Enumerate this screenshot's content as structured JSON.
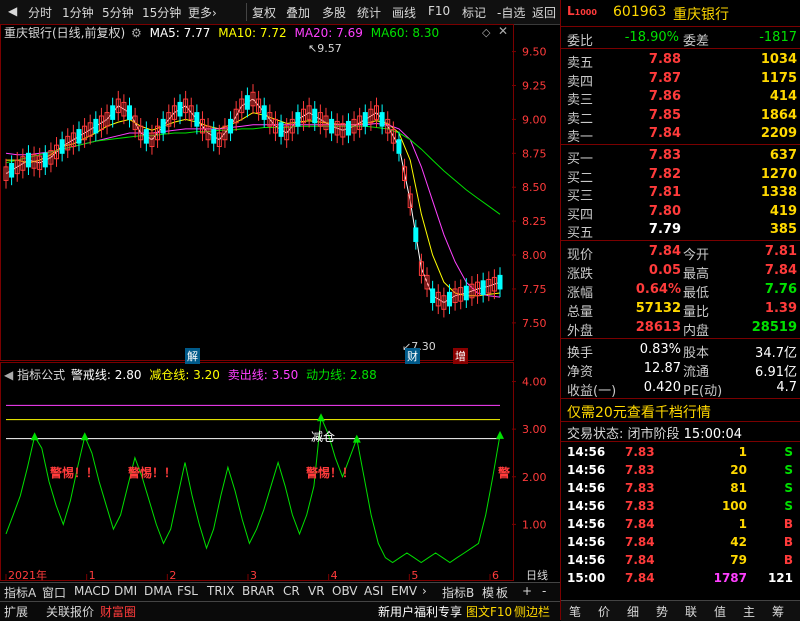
{
  "menu": {
    "items": [
      "分时",
      "1分钟",
      "5分钟",
      "15分钟",
      "更多›",
      "复权",
      "叠加",
      "多股",
      "统计",
      "画线",
      "F10",
      "标记",
      "-自选",
      "返回"
    ]
  },
  "main_chart": {
    "header": {
      "title": "重庆银行(日线,前复权)",
      "ma5_label": "MA5: 7.77",
      "ma10_label": "MA10: 7.72",
      "ma20_label": "MA20: 7.69",
      "ma60_label": "MA60: 8.30"
    },
    "annotation_high": "9.57",
    "annotation_low": "7.30",
    "markers": [
      "解",
      "财",
      "增"
    ],
    "colors": {
      "ma5": "#ffffff",
      "ma10": "#ffff00",
      "ma20": "#ff40ff",
      "ma60": "#00e000",
      "up": "#ff3b3b",
      "down": "#00ffff"
    }
  },
  "indicator": {
    "header": {
      "name": "指标公式",
      "warn_label": "警戒线: 2.80",
      "reduce_label": "减仓线: 3.20",
      "sell_label": "卖出线: 3.50",
      "power_label": "动力线: 2.88"
    },
    "warn_texts": [
      "警惕！！",
      "警惕！！",
      "警惕！！",
      "警"
    ],
    "reduce_text": "减仓"
  },
  "chart_data": [
    {
      "type": "candlestick",
      "title": "重庆银行(日线,前复权)",
      "ylim": [
        7.3,
        9.6
      ],
      "yticks": [
        7.5,
        7.75,
        8.0,
        8.25,
        8.5,
        8.75,
        9.0,
        9.25,
        9.5
      ],
      "ytick_labels": [
        "7.50",
        "7.75",
        "8.00",
        "8.25",
        "8.50",
        "8.75",
        "9.00",
        "9.25",
        "9.50"
      ],
      "series": [
        {
          "name": "MA5: 7.77",
          "values": [
            8.6,
            8.65,
            8.7,
            8.68,
            8.72,
            8.8,
            8.85,
            8.9,
            8.95,
            9.0,
            9.1,
            9.05,
            8.9,
            8.85,
            8.95,
            9.05,
            9.1,
            9.0,
            8.9,
            8.85,
            8.95,
            9.1,
            9.15,
            9.05,
            8.95,
            8.9,
            9.0,
            9.05,
            9.0,
            8.95,
            8.92,
            8.95,
            9.0,
            9.05,
            8.95,
            8.8,
            8.4,
            7.9,
            7.7,
            7.65,
            7.7,
            7.72,
            7.75,
            7.77,
            7.8
          ]
        },
        {
          "name": "MA10: 7.72",
          "values": [
            8.7,
            8.7,
            8.68,
            8.7,
            8.74,
            8.8,
            8.82,
            8.86,
            8.9,
            8.95,
            8.98,
            9.0,
            8.95,
            8.92,
            8.95,
            8.98,
            9.0,
            8.98,
            8.95,
            8.93,
            8.96,
            9.0,
            9.05,
            9.03,
            9.0,
            8.97,
            8.98,
            8.99,
            8.98,
            8.97,
            8.96,
            8.96,
            8.97,
            8.99,
            8.97,
            8.9,
            8.7,
            8.3,
            8.0,
            7.8,
            7.72,
            7.7,
            7.7,
            7.71,
            7.72
          ]
        },
        {
          "name": "MA20: 7.69",
          "values": [
            8.75,
            8.74,
            8.74,
            8.75,
            8.76,
            8.78,
            8.8,
            8.82,
            8.84,
            8.86,
            8.88,
            8.9,
            8.9,
            8.9,
            8.91,
            8.92,
            8.93,
            8.93,
            8.93,
            8.93,
            8.94,
            8.95,
            8.96,
            8.96,
            8.96,
            8.96,
            8.96,
            8.96,
            8.96,
            8.96,
            8.96,
            8.96,
            8.96,
            8.97,
            8.96,
            8.93,
            8.85,
            8.65,
            8.4,
            8.15,
            7.95,
            7.8,
            7.72,
            7.7,
            7.69
          ]
        },
        {
          "name": "MA60: 8.30",
          "values": [
            8.68,
            8.7,
            8.72,
            8.74,
            8.76,
            8.78,
            8.8,
            8.82,
            8.84,
            8.85,
            8.86,
            8.87,
            8.88,
            8.88,
            8.89,
            8.9,
            8.9,
            8.91,
            8.91,
            8.92,
            8.92,
            8.93,
            8.93,
            8.94,
            8.94,
            8.94,
            8.95,
            8.95,
            8.95,
            8.95,
            8.95,
            8.95,
            8.95,
            8.94,
            8.93,
            8.9,
            8.85,
            8.78,
            8.7,
            8.62,
            8.55,
            8.48,
            8.42,
            8.36,
            8.3
          ]
        }
      ],
      "annotations": [
        "9.57",
        "7.30"
      ]
    },
    {
      "type": "line",
      "title": "指标公式",
      "ylim": [
        0,
        4.2
      ],
      "yticks": [
        1.0,
        2.0,
        3.0,
        4.0
      ],
      "ytick_labels": [
        "1.00",
        "2.00",
        "3.00",
        "4.00"
      ],
      "x_labels": [
        "2021年",
        "1",
        "2",
        "3",
        "4",
        "5",
        "6"
      ],
      "xlabel": "日线",
      "series": [
        {
          "name": "警戒线: 2.80",
          "values": [
            2.8,
            2.8
          ]
        },
        {
          "name": "减仓线: 3.20",
          "values": [
            3.2,
            3.2
          ]
        },
        {
          "name": "卖出线: 3.50",
          "values": [
            3.5,
            3.5
          ]
        },
        {
          "name": "动力线: 2.88",
          "values": [
            0.8,
            1.2,
            1.6,
            2.2,
            2.85,
            2.6,
            1.9,
            1.4,
            1.0,
            1.5,
            2.2,
            2.85,
            2.5,
            1.9,
            1.4,
            0.9,
            1.2,
            1.8,
            2.4,
            2.0,
            1.5,
            1.0,
            0.6,
            0.9,
            1.6,
            2.3,
            1.6,
            1.0,
            0.5,
            0.9,
            1.6,
            2.2,
            1.7,
            1.1,
            0.6,
            0.9,
            1.3,
            1.8,
            2.3,
            1.8,
            1.2,
            0.8,
            1.2,
            1.8,
            3.25,
            2.9,
            2.4,
            2.0,
            2.4,
            2.8,
            2.0,
            1.2,
            0.6,
            0.3,
            0.2,
            0.3,
            0.4,
            0.3,
            0.2,
            0.3,
            0.4,
            0.3,
            0.2,
            0.3,
            0.4,
            0.5,
            0.6,
            1.2,
            2.0,
            2.88
          ]
        }
      ]
    }
  ],
  "quote_panel": {
    "code": "601963",
    "name": "重庆银行",
    "weibi_label": "委比",
    "weibi": "-18.90%",
    "weicha_label": "委差",
    "weicha": "-1817",
    "asks": [
      {
        "label": "卖五",
        "price": "7.88",
        "vol": "1034"
      },
      {
        "label": "卖四",
        "price": "7.87",
        "vol": "1175"
      },
      {
        "label": "卖三",
        "price": "7.86",
        "vol": "414"
      },
      {
        "label": "卖二",
        "price": "7.85",
        "vol": "1864"
      },
      {
        "label": "卖一",
        "price": "7.84",
        "vol": "2209"
      }
    ],
    "bids": [
      {
        "label": "买一",
        "price": "7.83",
        "vol": "637"
      },
      {
        "label": "买二",
        "price": "7.82",
        "vol": "1270"
      },
      {
        "label": "买三",
        "price": "7.81",
        "vol": "1338"
      },
      {
        "label": "买四",
        "price": "7.80",
        "vol": "419"
      },
      {
        "label": "买五",
        "price": "7.79",
        "vol": "385"
      }
    ],
    "stats": [
      {
        "l1": "现价",
        "v1": "7.84",
        "l2": "今开",
        "v2": "7.81"
      },
      {
        "l1": "涨跌",
        "v1": "0.05",
        "l2": "最高",
        "v2": "7.84"
      },
      {
        "l1": "涨幅",
        "v1": "0.64%",
        "l2": "最低",
        "v2": "7.76"
      },
      {
        "l1": "总量",
        "v1": "57132",
        "l2": "量比",
        "v2": "1.39"
      },
      {
        "l1": "外盘",
        "v1": "28613",
        "l2": "内盘",
        "v2": "28519"
      }
    ],
    "stats2": [
      {
        "l1": "换手",
        "v1": "0.83%",
        "l2": "股本",
        "v2": "34.7亿"
      },
      {
        "l1": "净资",
        "v1": "12.87",
        "l2": "流通",
        "v2": "6.91亿"
      },
      {
        "l1": "收益(一)",
        "v1": "0.420",
        "l2": "PE(动)",
        "v2": "4.7"
      }
    ],
    "promo": "仅需20元查看千档行情",
    "status_label": "交易状态: 闭市阶段",
    "status_time": "15:00:04",
    "ticks": [
      {
        "time": "14:56",
        "price": "7.83",
        "vol": "1",
        "bs": "S"
      },
      {
        "time": "14:56",
        "price": "7.83",
        "vol": "20",
        "bs": "S"
      },
      {
        "time": "14:56",
        "price": "7.83",
        "vol": "81",
        "bs": "S"
      },
      {
        "time": "14:56",
        "price": "7.83",
        "vol": "100",
        "bs": "S"
      },
      {
        "time": "14:56",
        "price": "7.84",
        "vol": "1",
        "bs": "B"
      },
      {
        "time": "14:56",
        "price": "7.84",
        "vol": "42",
        "bs": "B"
      },
      {
        "time": "14:56",
        "price": "7.84",
        "vol": "79",
        "bs": "B"
      },
      {
        "time": "15:00",
        "price": "7.84",
        "vol": "1787",
        "bs": "121"
      }
    ]
  },
  "bottom_tabs": {
    "row1": [
      "指标A",
      "窗口",
      "MACD",
      "DMI",
      "DMA",
      "FSL",
      "TRIX",
      "BRAR",
      "CR",
      "VR",
      "OBV",
      "ASI",
      "EMV",
      "›",
      "指标B",
      "模",
      "板",
      "+",
      "-"
    ],
    "row2_left": [
      "扩展",
      "关联报价",
      "财富圈"
    ],
    "row2_right": [
      "新用户福利专享",
      "图文F10",
      "侧边栏"
    ]
  },
  "right_bottom": [
    "笔",
    "价",
    "细",
    "势",
    "联",
    "值",
    "主",
    "筹"
  ]
}
